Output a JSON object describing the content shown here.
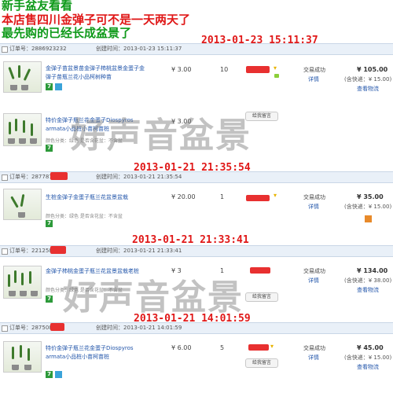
{
  "header": {
    "line1": "新手盆友看看",
    "line2": "本店售四川金弹子可不是一天两天了",
    "line3": "最先购的已经长成盆景了"
  },
  "watermark": "好声音盆景",
  "orders": [
    {
      "big_date": "2013-01-23 15:11:37",
      "order_no": "订单号：2886923232",
      "created": "创建时间：2013-01-23 15:11:37",
      "items": [
        {
          "title": "金弹子苗盆景苗金弹子柿桃盆景金蛋子金弹子苗瓶兰花小品柯树种苗",
          "price": "¥ 3.00",
          "qty": "10",
          "msg_btn": "",
          "attr": ""
        },
        {
          "title": "特价金弹子瓶兰花金蛋子Diospyros armata小品桩小苗柯苗桩",
          "price": "¥ 3.00",
          "qty": "",
          "msg_btn": "给我留言",
          "attr": "颜色分类：绿色 是否含花盆：不含盆"
        }
      ],
      "status": "交易成功",
      "detail": "详情",
      "total": "¥ 105.00",
      "shipping": "(含快递：¥ 15.00)",
      "logistics": "查看物流"
    },
    {
      "big_date": "2013-01-21 21:35:54",
      "order_no": "订单号：2877876",
      "created": "创建时间：2013-01-21 21:35:54",
      "items": [
        {
          "title": "生桩金弹子金蛋子瓶兰花盆景盆栽",
          "price": "¥ 20.00",
          "qty": "1",
          "msg_btn": "",
          "attr": "颜色分类：绿色 是否含花盆：不含盆"
        }
      ],
      "status": "交易成功",
      "detail": "详情",
      "total": "¥ 35.00",
      "shipping": "(含快递：¥ 15.00)",
      "logistics": ""
    },
    {
      "big_date": "2013-01-21 21:33:41",
      "order_no": "订单号：2212589",
      "created": "创建时间：2013-01-21 21:33:41",
      "items": [
        {
          "title": "金弹子柿桃金蛋子瓶兰花盆景盆栽老桩",
          "price": "¥ 3",
          "qty": "1",
          "msg_btn": "给我留言",
          "attr": "颜色分类：绿色 是否含花盆：不含盆"
        }
      ],
      "status": "交易成功",
      "detail": "详情",
      "total": "¥ 134.00",
      "shipping": "(含快递：¥ 38.00)",
      "logistics": "查看物流"
    },
    {
      "big_date": "2013-01-21 14:01:59",
      "order_no": "订单号：2875086",
      "created": "创建时间：2013-01-21 14:01:59",
      "items": [
        {
          "title": "特价金弹子瓶兰花金蛋子Diospyros armata小品桩小苗柯苗桩",
          "price": "¥ 6.00",
          "qty": "5",
          "msg_btn": "给我留言",
          "attr": ""
        }
      ],
      "status": "交易成功",
      "detail": "详情",
      "total": "¥ 45.00",
      "shipping": "(含快递：¥ 15.00)",
      "logistics": "查看物流"
    }
  ],
  "colors": {
    "header_green": "#0f9a1a",
    "header_red": "#e01818",
    "order_row_bg": "#e9f0f8",
    "link_blue": "#2255aa"
  }
}
